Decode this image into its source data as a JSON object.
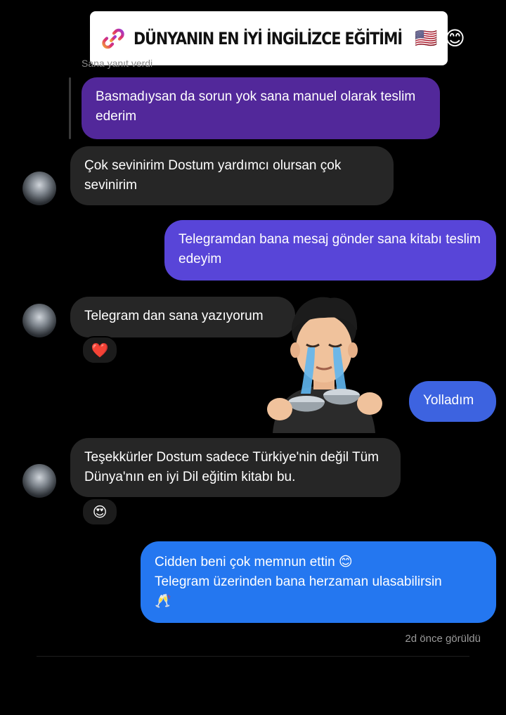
{
  "banner": {
    "title": "DÜNYANIN EN İYİ İNGİLİZCE EĞİTİMİ",
    "flag": "🇺🇸",
    "smile": "😊",
    "icon": "link-icon"
  },
  "chat": {
    "reply_label": "Sana yanıt verdi",
    "quoted_message": "Basmadıysan da sorun yok sana manuel olarak teslim ederim",
    "messages": [
      {
        "from": "them",
        "text": "Çok sevinirim Dostum yardımcı olursan çok sevinirim"
      },
      {
        "from": "me",
        "text": "Telegramdan bana mesaj gönder sana kitabı teslim edeyim"
      },
      {
        "from": "them",
        "text": "Telegram dan sana yazıyorum",
        "reaction": "❤️"
      },
      {
        "from": "me",
        "text": "Yolladım"
      },
      {
        "from": "them",
        "text": "Teşekkürler Dostum sadece Türkiye'nin değil Tüm Dünya'nın en iyi Dil eğitim kitabı bu.",
        "reaction": "😍"
      },
      {
        "from": "me",
        "lines": [
          "Cidden beni çok memnun ettin 😊",
          "Telegram üzerinden bana herzaman ulasabilirsin",
          "🥂"
        ]
      }
    ],
    "seen_status": "2d önce görüldü"
  },
  "colors": {
    "quoted": "#52289a",
    "incoming": "#262626",
    "outgoing_1": "#5845d8",
    "outgoing_2": "#3d63e0",
    "outgoing_3": "#2477f0"
  }
}
